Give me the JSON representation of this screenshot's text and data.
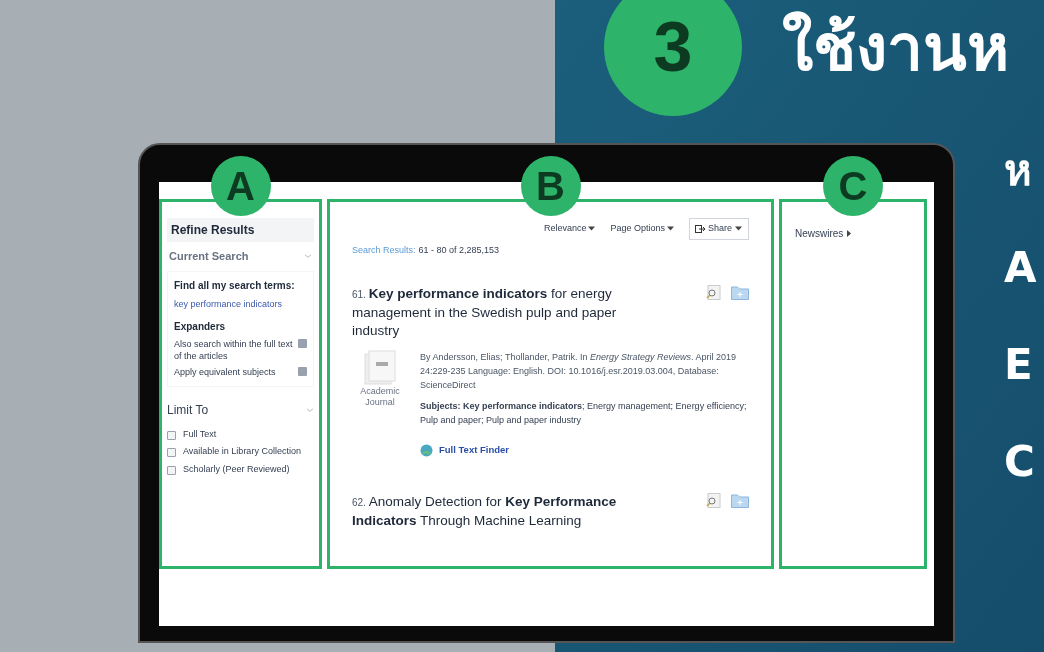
{
  "headline": {
    "step": "3",
    "title": "ใช้งานห"
  },
  "side_letters": [
    "ห",
    "A",
    "E",
    "C"
  ],
  "sidebar": {
    "badge": "A",
    "title": "Refine Results",
    "current_search": {
      "heading": "Current Search",
      "find_label": "Find all my search terms:",
      "terms": "key performance indicators",
      "expanders_heading": "Expanders",
      "expanders": [
        {
          "label": "Also search within the full text of the articles"
        },
        {
          "label": "Apply equivalent subjects"
        }
      ]
    },
    "limit_to": {
      "heading": "Limit To",
      "options": [
        {
          "label": "Full Text",
          "checked": false
        },
        {
          "label": "Available in Library Collection",
          "checked": false
        },
        {
          "label": "Scholarly (Peer Reviewed)",
          "checked": false
        }
      ]
    }
  },
  "results": {
    "badge": "B",
    "menus": [
      "Relevance",
      "Page Options"
    ],
    "share": "Share",
    "summary_label": "Search Results:",
    "summary_value": "61 - 80 of 2,285,153",
    "items": [
      {
        "number": "61.",
        "title": "**Key performance indicators** for energy management in the Swedish pulp and paper industry",
        "type": "Academic Journal",
        "citation": "By Andersson, Elias; Thollander, Patrik. In *Energy Strategy Reviews*. April 2019 24:229-235 Language: English. DOI: 10.1016/j.esr.2019.03.004, Database: ScienceDirect",
        "subjects": "**Subjects: Key performance indicators**; Energy management; Energy efficiency; Pulp and paper; Pulp and paper industry",
        "link": "Full Text Finder"
      },
      {
        "number": "62.",
        "title": "Anomaly Detection for **Key Performance Indicators** Through Machine Learning"
      }
    ]
  },
  "right_column": {
    "badge": "C",
    "link": "Newswires"
  }
}
